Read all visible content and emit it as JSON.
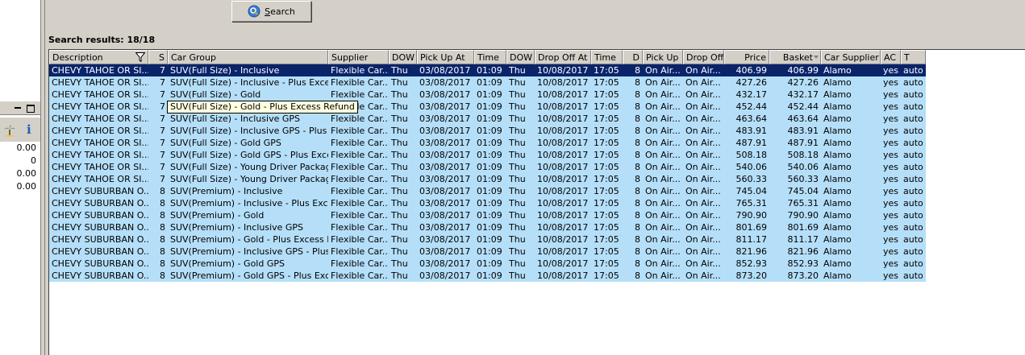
{
  "toolbar": {
    "search_label": "Search"
  },
  "results": {
    "label": "Search results: 18/18"
  },
  "side_panel": {
    "values": [
      "0.00",
      "0",
      "0.00",
      "0.00"
    ]
  },
  "tooltip": {
    "text": "SUV(Full Size) - Gold - Plus Excess Refund"
  },
  "columns": [
    {
      "key": "desc",
      "label": "Description"
    },
    {
      "key": "s",
      "label": "S"
    },
    {
      "key": "group",
      "label": "Car Group"
    },
    {
      "key": "supplier",
      "label": "Supplier"
    },
    {
      "key": "dow1",
      "label": "DOW"
    },
    {
      "key": "pickup_at",
      "label": "Pick Up At"
    },
    {
      "key": "time1",
      "label": "Time"
    },
    {
      "key": "dow2",
      "label": "DOW"
    },
    {
      "key": "dropoff_at",
      "label": "Drop Off At"
    },
    {
      "key": "time2",
      "label": "Time"
    },
    {
      "key": "d",
      "label": "D"
    },
    {
      "key": "pickup",
      "label": "Pick Up"
    },
    {
      "key": "dropoff",
      "label": "Drop Off"
    },
    {
      "key": "price",
      "label": "Price"
    },
    {
      "key": "basket",
      "label": "Basket"
    },
    {
      "key": "car_supplier",
      "label": "Car Supplier"
    },
    {
      "key": "ac",
      "label": "AC"
    },
    {
      "key": "t",
      "label": "T"
    }
  ],
  "rows": [
    [
      "CHEVY TAHOE OR SI...",
      "7",
      "SUV(Full Size) - Inclusive",
      "Flexible Car...",
      "Thu",
      "03/08/2017",
      "01:09",
      "Thu",
      "10/08/2017",
      "17:05",
      "8",
      "On Air...",
      "On Air...",
      "406.99",
      "406.99",
      "Alamo",
      "yes",
      "auto"
    ],
    [
      "CHEVY TAHOE OR SI...",
      "7",
      "SUV(Full Size) - Inclusive - Plus Excess...",
      "Flexible Car...",
      "Thu",
      "03/08/2017",
      "01:09",
      "Thu",
      "10/08/2017",
      "17:05",
      "8",
      "On Air...",
      "On Air...",
      "427.26",
      "427.26",
      "Alamo",
      "yes",
      "auto"
    ],
    [
      "CHEVY TAHOE OR SI...",
      "7",
      "SUV(Full Size) - Gold",
      "Flexible Car...",
      "Thu",
      "03/08/2017",
      "01:09",
      "Thu",
      "10/08/2017",
      "17:05",
      "8",
      "On Air...",
      "On Air...",
      "432.17",
      "432.17",
      "Alamo",
      "yes",
      "auto"
    ],
    [
      "CHEVY TAHOE OR SI...",
      "7",
      "SUV(Full Size) - Gold - Plus Excess Refund",
      "Flexible Car...",
      "Thu",
      "03/08/2017",
      "01:09",
      "Thu",
      "10/08/2017",
      "17:05",
      "8",
      "On Air...",
      "On Air...",
      "452.44",
      "452.44",
      "Alamo",
      "yes",
      "auto"
    ],
    [
      "CHEVY TAHOE OR SI...",
      "7",
      "SUV(Full Size) - Inclusive GPS",
      "Flexible Car...",
      "Thu",
      "03/08/2017",
      "01:09",
      "Thu",
      "10/08/2017",
      "17:05",
      "8",
      "On Air...",
      "On Air...",
      "463.64",
      "463.64",
      "Alamo",
      "yes",
      "auto"
    ],
    [
      "CHEVY TAHOE OR SI...",
      "7",
      "SUV(Full Size) - Inclusive GPS - Plus E...",
      "Flexible Car...",
      "Thu",
      "03/08/2017",
      "01:09",
      "Thu",
      "10/08/2017",
      "17:05",
      "8",
      "On Air...",
      "On Air...",
      "483.91",
      "483.91",
      "Alamo",
      "yes",
      "auto"
    ],
    [
      "CHEVY TAHOE OR SI...",
      "7",
      "SUV(Full Size) - Gold GPS",
      "Flexible Car...",
      "Thu",
      "03/08/2017",
      "01:09",
      "Thu",
      "10/08/2017",
      "17:05",
      "8",
      "On Air...",
      "On Air...",
      "487.91",
      "487.91",
      "Alamo",
      "yes",
      "auto"
    ],
    [
      "CHEVY TAHOE OR SI...",
      "7",
      "SUV(Full Size) - Gold GPS - Plus Exces...",
      "Flexible Car...",
      "Thu",
      "03/08/2017",
      "01:09",
      "Thu",
      "10/08/2017",
      "17:05",
      "8",
      "On Air...",
      "On Air...",
      "508.18",
      "508.18",
      "Alamo",
      "yes",
      "auto"
    ],
    [
      "CHEVY TAHOE OR SI...",
      "7",
      "SUV(Full Size) - Young Driver Package...",
      "Flexible Car...",
      "Thu",
      "03/08/2017",
      "01:09",
      "Thu",
      "10/08/2017",
      "17:05",
      "8",
      "On Air...",
      "On Air...",
      "540.06",
      "540.06",
      "Alamo",
      "yes",
      "auto"
    ],
    [
      "CHEVY TAHOE OR SI...",
      "7",
      "SUV(Full Size) - Young Driver Package...",
      "Flexible Car...",
      "Thu",
      "03/08/2017",
      "01:09",
      "Thu",
      "10/08/2017",
      "17:05",
      "8",
      "On Air...",
      "On Air...",
      "560.33",
      "560.33",
      "Alamo",
      "yes",
      "auto"
    ],
    [
      "CHEVY SUBURBAN O...",
      "8",
      "SUV(Premium) - Inclusive",
      "Flexible Car...",
      "Thu",
      "03/08/2017",
      "01:09",
      "Thu",
      "10/08/2017",
      "17:05",
      "8",
      "On Air...",
      "On Air...",
      "745.04",
      "745.04",
      "Alamo",
      "yes",
      "auto"
    ],
    [
      "CHEVY SUBURBAN O...",
      "8",
      "SUV(Premium) - Inclusive - Plus Exces...",
      "Flexible Car...",
      "Thu",
      "03/08/2017",
      "01:09",
      "Thu",
      "10/08/2017",
      "17:05",
      "8",
      "On Air...",
      "On Air...",
      "765.31",
      "765.31",
      "Alamo",
      "yes",
      "auto"
    ],
    [
      "CHEVY SUBURBAN O...",
      "8",
      "SUV(Premium) - Gold",
      "Flexible Car...",
      "Thu",
      "03/08/2017",
      "01:09",
      "Thu",
      "10/08/2017",
      "17:05",
      "8",
      "On Air...",
      "On Air...",
      "790.90",
      "790.90",
      "Alamo",
      "yes",
      "auto"
    ],
    [
      "CHEVY SUBURBAN O...",
      "8",
      "SUV(Premium) - Inclusive GPS",
      "Flexible Car...",
      "Thu",
      "03/08/2017",
      "01:09",
      "Thu",
      "10/08/2017",
      "17:05",
      "8",
      "On Air...",
      "On Air...",
      "801.69",
      "801.69",
      "Alamo",
      "yes",
      "auto"
    ],
    [
      "CHEVY SUBURBAN O...",
      "8",
      "SUV(Premium) - Gold - Plus Excess Re...",
      "Flexible Car...",
      "Thu",
      "03/08/2017",
      "01:09",
      "Thu",
      "10/08/2017",
      "17:05",
      "8",
      "On Air...",
      "On Air...",
      "811.17",
      "811.17",
      "Alamo",
      "yes",
      "auto"
    ],
    [
      "CHEVY SUBURBAN O...",
      "8",
      "SUV(Premium) - Inclusive GPS - Plus E...",
      "Flexible Car...",
      "Thu",
      "03/08/2017",
      "01:09",
      "Thu",
      "10/08/2017",
      "17:05",
      "8",
      "On Air...",
      "On Air...",
      "821.96",
      "821.96",
      "Alamo",
      "yes",
      "auto"
    ],
    [
      "CHEVY SUBURBAN O...",
      "8",
      "SUV(Premium) - Gold GPS",
      "Flexible Car...",
      "Thu",
      "03/08/2017",
      "01:09",
      "Thu",
      "10/08/2017",
      "17:05",
      "8",
      "On Air...",
      "On Air...",
      "852.93",
      "852.93",
      "Alamo",
      "yes",
      "auto"
    ],
    [
      "CHEVY SUBURBAN O...",
      "8",
      "SUV(Premium) - Gold GPS - Plus Exces...",
      "Flexible Car...",
      "Thu",
      "03/08/2017",
      "01:09",
      "Thu",
      "10/08/2017",
      "17:05",
      "8",
      "On Air...",
      "On Air...",
      "873.20",
      "873.20",
      "Alamo",
      "yes",
      "auto"
    ]
  ],
  "colors": {
    "row_bg": "#b5dff9",
    "selected_row_bg": "#0a246a",
    "selected_row_fg": "#ffffff",
    "chrome": "#d4d0c8",
    "tooltip_bg": "#ffffe1"
  }
}
